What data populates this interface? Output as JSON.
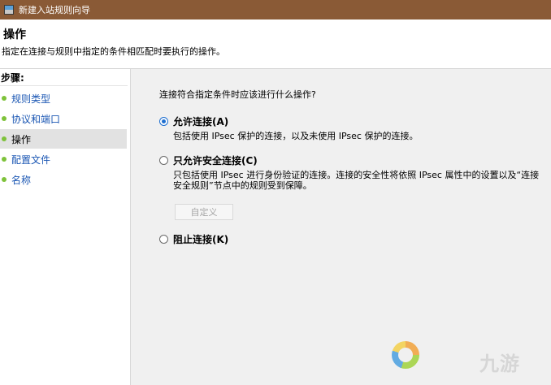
{
  "window": {
    "title": "新建入站规则向导"
  },
  "header": {
    "title": "操作",
    "description": "指定在连接与规则中指定的条件相匹配时要执行的操作。"
  },
  "sidebar": {
    "steps_label": "步骤:",
    "items": [
      {
        "label": "规则类型",
        "active": false
      },
      {
        "label": "协议和端口",
        "active": false
      },
      {
        "label": "操作",
        "active": true
      },
      {
        "label": "配置文件",
        "active": false
      },
      {
        "label": "名称",
        "active": false
      }
    ]
  },
  "main": {
    "question": "连接符合指定条件时应该进行什么操作?",
    "options": [
      {
        "label": "允许连接(A)",
        "checked": true,
        "description": "包括使用 IPsec 保护的连接，以及未使用 IPsec 保护的连接。"
      },
      {
        "label": "只允许安全连接(C)",
        "checked": false,
        "description": "只包括使用 IPsec 进行身份验证的连接。连接的安全性将依照 IPsec 属性中的设置以及“连接安全规则”节点中的规则受到保障。"
      },
      {
        "label": "阻止连接(K)",
        "checked": false
      }
    ],
    "customize_button": "自定义"
  },
  "watermark": {
    "text": "九游"
  },
  "colors": {
    "titlebar": "#8a5a36",
    "step_dot": "#7ec23a",
    "radio_selected": "#1e6fd0"
  }
}
